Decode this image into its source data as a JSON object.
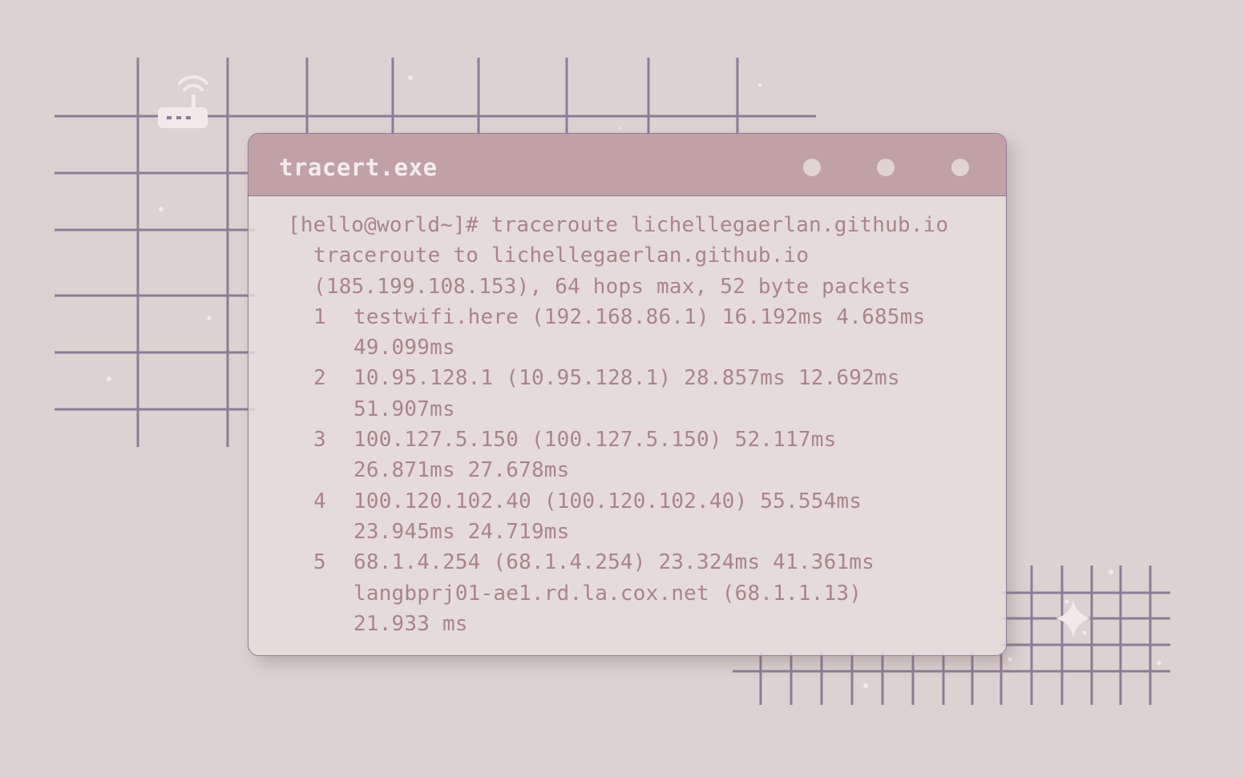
{
  "window": {
    "title": "tracert.exe",
    "controls": [
      "minimize",
      "maximize",
      "close"
    ]
  },
  "terminal": {
    "prompt": "[hello@world~]# traceroute lichellegaerlan.github.io",
    "header_lines": [
      "traceroute to lichellegaerlan.github.io",
      "(185.199.108.153), 64 hops max, 52 byte packets"
    ],
    "hops": [
      {
        "num": "1",
        "lines": [
          "testwifi.here (192.168.86.1) 16.192ms 4.685ms",
          "49.099ms"
        ]
      },
      {
        "num": "2",
        "lines": [
          "10.95.128.1 (10.95.128.1) 28.857ms 12.692ms",
          "51.907ms"
        ]
      },
      {
        "num": "3",
        "lines": [
          "100.127.5.150 (100.127.5.150) 52.117ms",
          "26.871ms 27.678ms"
        ]
      },
      {
        "num": "4",
        "lines": [
          "100.120.102.40 (100.120.102.40) 55.554ms",
          "23.945ms 24.719ms"
        ]
      },
      {
        "num": "5",
        "lines": [
          "68.1.4.254 (68.1.4.254) 23.324ms 41.361ms",
          "langbprj01-ae1.rd.la.cox.net (68.1.1.13)",
          "21.933 ms"
        ]
      }
    ]
  },
  "decor": {
    "icons": [
      "wifi-router-icon",
      "sparkle-icon"
    ],
    "colors": {
      "background": "#dcd2d1",
      "grid": "#8e7c96",
      "titlebar": "#b79498",
      "text": "#a7868a"
    }
  }
}
